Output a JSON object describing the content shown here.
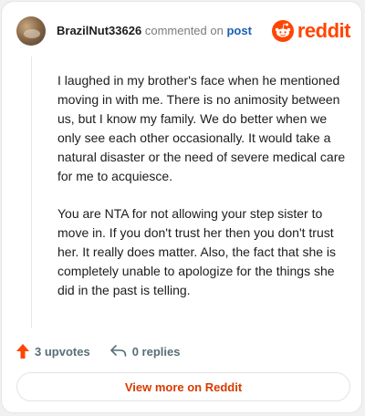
{
  "comment": {
    "username": "BrazilNut33626",
    "action_text": "commented on",
    "target_link": "post",
    "paragraphs": [
      "I laughed in my brother's face when he mentioned moving in with me. There is no animosity between us, but I know my family. We do better when we only see each other occasionally. It would take a natural disaster or the need of severe medical care for me to acquiesce.",
      "You are NTA for not allowing your step sister to move in. If you don't trust her then you don't trust her. It really does matter. Also, the fact that she is completely unable to apologize for the things she did in the past is telling."
    ],
    "upvotes_label": "3 upvotes",
    "replies_label": "0 replies"
  },
  "brand": {
    "logo_text": "reddit",
    "color": "#ff4500"
  },
  "footer": {
    "view_button_label": "View more on Reddit"
  },
  "icons": {
    "upvote": "upvote-arrow-icon",
    "reply": "reply-arrow-icon",
    "logo": "reddit-snoo-icon"
  }
}
